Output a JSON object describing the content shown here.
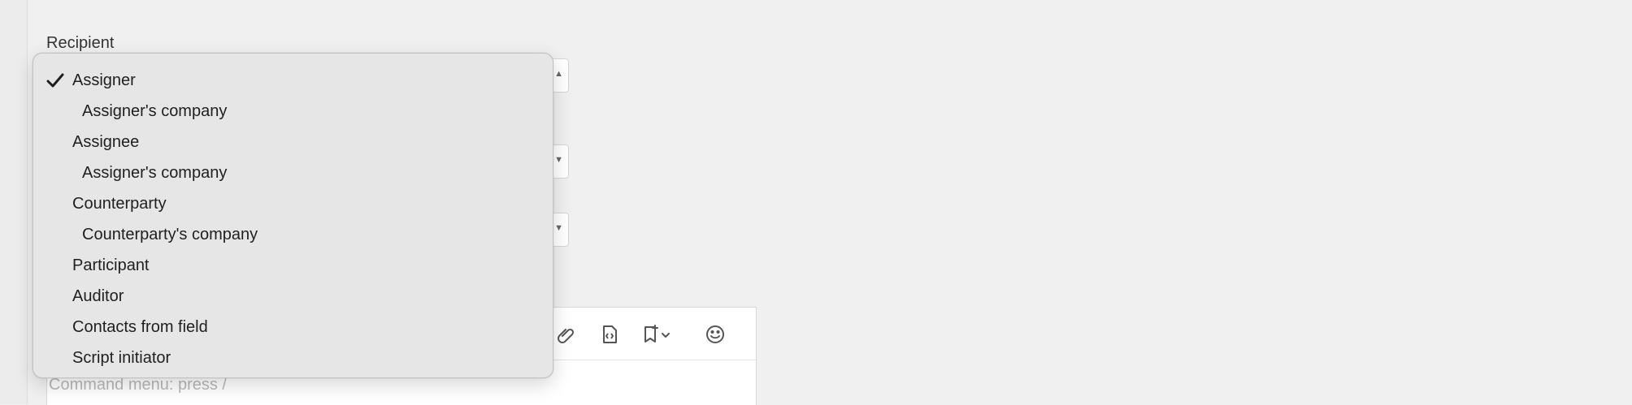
{
  "form": {
    "recipient_label": "Recipient"
  },
  "recipient_menu": {
    "selected_index": 0,
    "items": [
      {
        "label": "Assigner",
        "indent": false,
        "selected": true
      },
      {
        "label": "Assigner's company",
        "indent": true,
        "selected": false
      },
      {
        "label": "Assignee",
        "indent": false,
        "selected": false
      },
      {
        "label": "Assigner's company",
        "indent": true,
        "selected": false
      },
      {
        "label": "Counterparty",
        "indent": false,
        "selected": false
      },
      {
        "label": "Counterparty's company",
        "indent": true,
        "selected": false
      },
      {
        "label": "Participant",
        "indent": false,
        "selected": false
      },
      {
        "label": "Auditor",
        "indent": false,
        "selected": false
      },
      {
        "label": "Contacts from field",
        "indent": false,
        "selected": false
      },
      {
        "label": "Script initiator",
        "indent": false,
        "selected": false
      }
    ]
  },
  "editor": {
    "placeholder": "Command menu: press /",
    "toolbar_icons": [
      "attachment-icon",
      "code-block-icon",
      "bookmark-add-icon",
      "emoji-icon"
    ]
  },
  "colors": {
    "page_bg": "#f0f0f0",
    "menu_bg": "#e6e6e7",
    "placeholder_text": "#b8b8b8"
  }
}
